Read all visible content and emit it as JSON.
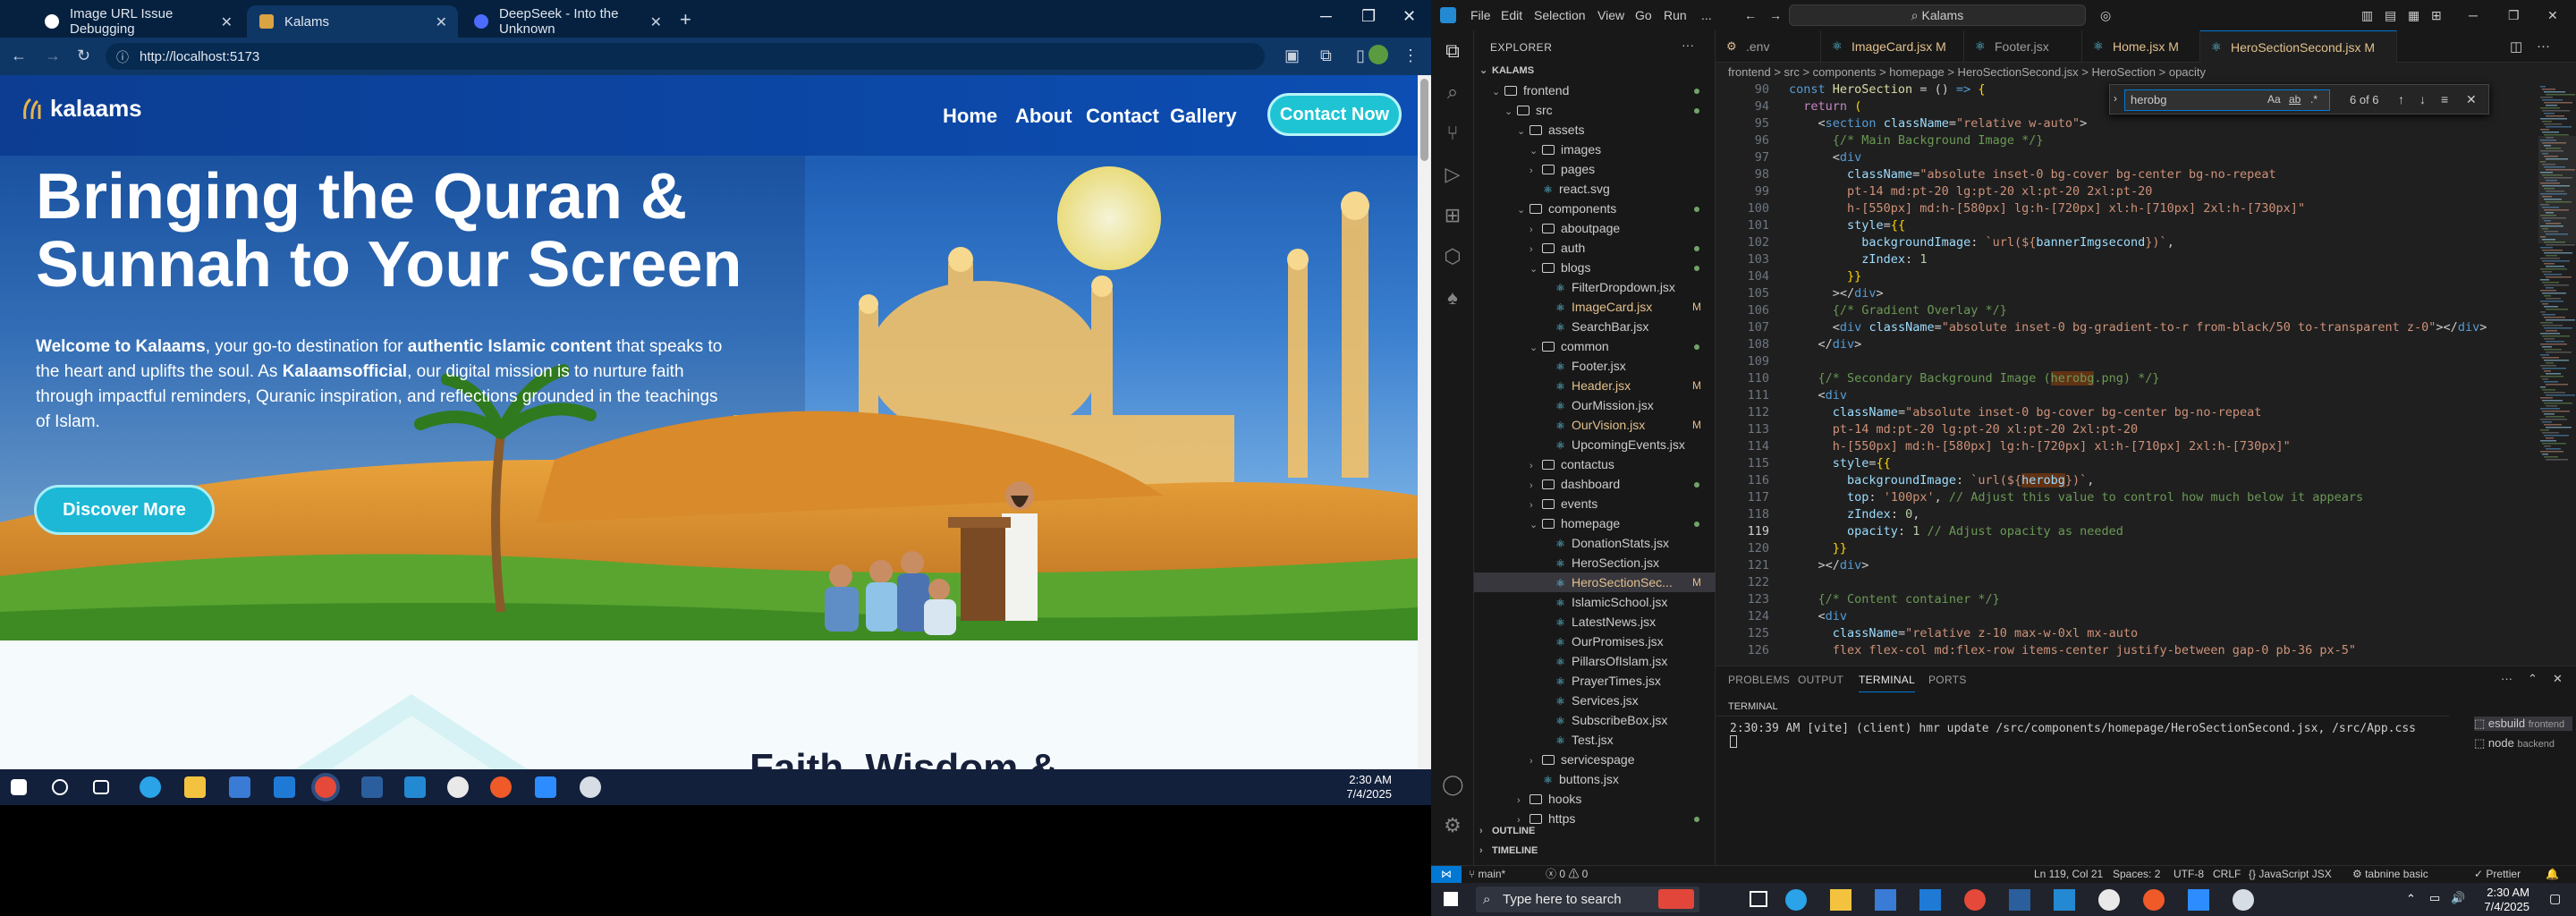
{
  "chrome": {
    "tabs": [
      {
        "title": "Image URL Issue Debugging",
        "icon": "chatgpt-icon",
        "active": false
      },
      {
        "title": "Kalams",
        "icon": "kalaams-icon",
        "active": true
      },
      {
        "title": "DeepSeek - Into the Unknown",
        "icon": "deepseek-icon",
        "active": false
      }
    ],
    "url": "http://localhost:5173"
  },
  "site": {
    "logo_text": "kalaams",
    "nav": [
      "Home",
      "About",
      "Contact",
      "Gallery"
    ],
    "contact_button": "Contact Now",
    "hero_title_line1": "Bringing the Quran &",
    "hero_title_line2": "Sunnah to Your Screen",
    "desc": {
      "p1": "Welcome to Kalaams",
      "p2": ", your go-to destination for ",
      "p3": "authentic Islamic content",
      "p4": " that speaks to the heart and uplifts the soul. As ",
      "p5": "Kalaamsofficial",
      "p6": ", our digital mission is to nurture faith through impactful reminders, Quranic inspiration, and reflections grounded in the teachings of Islam."
    },
    "discover_button": "Discover More",
    "section_heading": "Faith, Wisdom &"
  },
  "left_taskbar": {
    "time": "2:30 AM",
    "date": "7/4/2025"
  },
  "vscode": {
    "menu": [
      "File",
      "Edit",
      "Selection",
      "View",
      "Go",
      "Run",
      "..."
    ],
    "search": "Kalams",
    "explorer_title": "EXPLORER",
    "tree": [
      {
        "label": "KALAMS",
        "depth": 0,
        "type": "root"
      },
      {
        "label": "frontend",
        "depth": 1,
        "type": "folder-open",
        "dot": true
      },
      {
        "label": "src",
        "depth": 2,
        "type": "folder-open",
        "dot": true
      },
      {
        "label": "assets",
        "depth": 3,
        "type": "folder-open"
      },
      {
        "label": "images",
        "depth": 4,
        "type": "folder-open"
      },
      {
        "label": "pages",
        "depth": 4,
        "type": "folder"
      },
      {
        "label": "react.svg",
        "depth": 4,
        "type": "file"
      },
      {
        "label": "components",
        "depth": 3,
        "type": "folder-open",
        "dot": true
      },
      {
        "label": "aboutpage",
        "depth": 4,
        "type": "folder"
      },
      {
        "label": "auth",
        "depth": 4,
        "type": "folder",
        "dot": true
      },
      {
        "label": "blogs",
        "depth": 4,
        "type": "folder-open",
        "dot": true
      },
      {
        "label": "FilterDropdown.jsx",
        "depth": 5,
        "type": "file"
      },
      {
        "label": "ImageCard.jsx",
        "depth": 5,
        "type": "file",
        "badge": "M"
      },
      {
        "label": "SearchBar.jsx",
        "depth": 5,
        "type": "file"
      },
      {
        "label": "common",
        "depth": 4,
        "type": "folder-open",
        "dot": true
      },
      {
        "label": "Footer.jsx",
        "depth": 5,
        "type": "file"
      },
      {
        "label": "Header.jsx",
        "depth": 5,
        "type": "file",
        "badge": "M"
      },
      {
        "label": "OurMission.jsx",
        "depth": 5,
        "type": "file"
      },
      {
        "label": "OurVision.jsx",
        "depth": 5,
        "type": "file",
        "badge": "M"
      },
      {
        "label": "UpcomingEvents.jsx",
        "depth": 5,
        "type": "file"
      },
      {
        "label": "contactus",
        "depth": 4,
        "type": "folder"
      },
      {
        "label": "dashboard",
        "depth": 4,
        "type": "folder",
        "dot": true
      },
      {
        "label": "events",
        "depth": 4,
        "type": "folder"
      },
      {
        "label": "homepage",
        "depth": 4,
        "type": "folder-open",
        "dot": true
      },
      {
        "label": "DonationStats.jsx",
        "depth": 5,
        "type": "file"
      },
      {
        "label": "HeroSection.jsx",
        "depth": 5,
        "type": "file"
      },
      {
        "label": "HeroSectionSec...",
        "depth": 5,
        "type": "file",
        "badge": "M",
        "selected": true
      },
      {
        "label": "IslamicSchool.jsx",
        "depth": 5,
        "type": "file"
      },
      {
        "label": "LatestNews.jsx",
        "depth": 5,
        "type": "file"
      },
      {
        "label": "OurPromises.jsx",
        "depth": 5,
        "type": "file"
      },
      {
        "label": "PillarsOfIslam.jsx",
        "depth": 5,
        "type": "file"
      },
      {
        "label": "PrayerTimes.jsx",
        "depth": 5,
        "type": "file"
      },
      {
        "label": "Services.jsx",
        "depth": 5,
        "type": "file"
      },
      {
        "label": "SubscribeBox.jsx",
        "depth": 5,
        "type": "file"
      },
      {
        "label": "Test.jsx",
        "depth": 5,
        "type": "file"
      },
      {
        "label": "servicespage",
        "depth": 4,
        "type": "folder"
      },
      {
        "label": "buttons.jsx",
        "depth": 4,
        "type": "file"
      },
      {
        "label": "hooks",
        "depth": 3,
        "type": "folder"
      },
      {
        "label": "https",
        "depth": 3,
        "type": "folder",
        "dot": true
      }
    ],
    "outline": "OUTLINE",
    "timeline": "TIMELINE",
    "editor_tabs": [
      {
        "label": ".env",
        "mod": false,
        "active": false
      },
      {
        "label": "ImageCard.jsx",
        "badge": "M",
        "mod": true,
        "active": false
      },
      {
        "label": "Footer.jsx",
        "mod": false,
        "active": false
      },
      {
        "label": "Home.jsx",
        "badge": "M",
        "mod": true,
        "active": false
      },
      {
        "label": "HeroSectionSecond.jsx",
        "badge": "M",
        "mod": true,
        "active": true
      }
    ],
    "breadcrumb": "frontend > src > components > homepage > HeroSectionSecond.jsx > HeroSection > opacity",
    "find": {
      "query": "herobg",
      "result": "6 of 6",
      "opt_case": "Aa",
      "opt_word": "ab",
      "opt_regex": ".*"
    },
    "panel_tabs": [
      "PROBLEMS",
      "OUTPUT",
      "TERMINAL",
      "PORTS"
    ],
    "terminal_title": "TERMINAL",
    "terminal_line": "2:30:39 AM [vite] (client) hmr update /src/components/homepage/HeroSectionSecond.jsx, /src/App.css",
    "terminal_list": [
      {
        "name": "esbuild",
        "cwd": "frontend"
      },
      {
        "name": "node",
        "cwd": "backend"
      }
    ],
    "status": {
      "branch": "main*",
      "problems": "0 ⚠ 0",
      "position": "Ln 119, Col 21",
      "spaces": "Spaces: 2",
      "encoding": "UTF-8",
      "eol": "CRLF",
      "language": "JavaScript JSX",
      "tabnine": "tabnine basic",
      "prettier": "Prettier"
    }
  },
  "right_taskbar": {
    "search_placeholder": "Type here to search",
    "time": "2:30 AM",
    "date": "7/4/2025"
  }
}
